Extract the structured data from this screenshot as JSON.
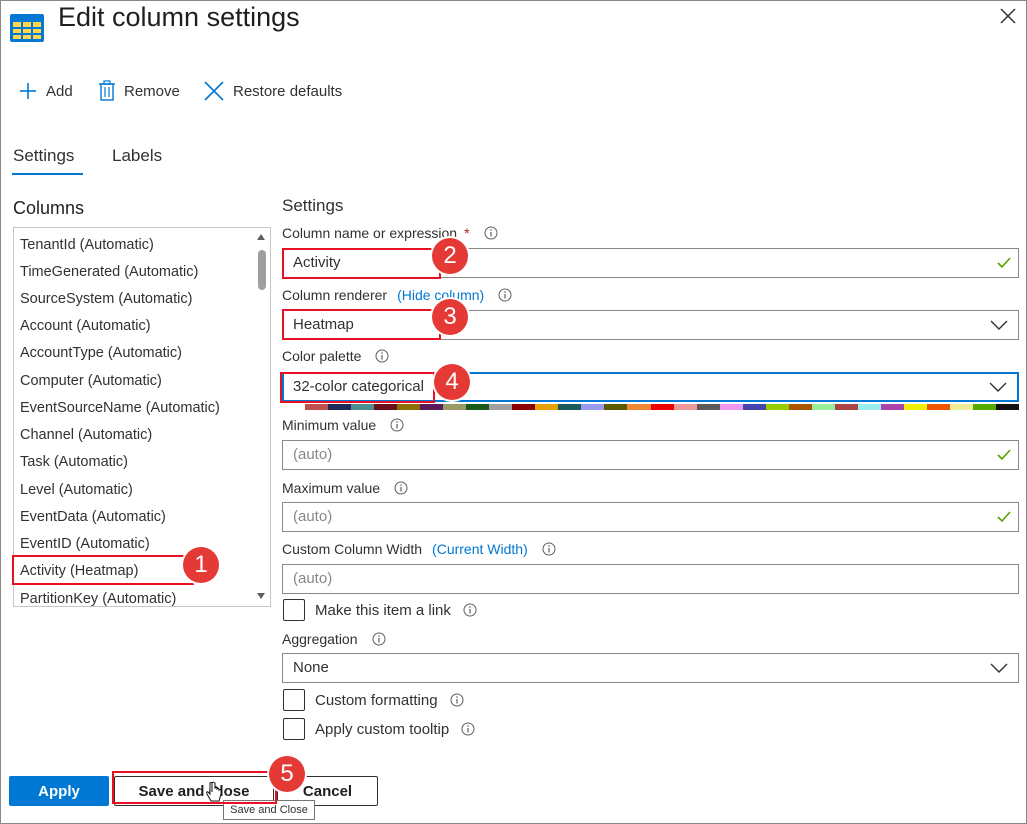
{
  "header": {
    "title": "Edit column settings",
    "close_icon": "close-icon",
    "title_icon": "table-icon"
  },
  "toolbar": {
    "add_label": "Add",
    "remove_label": "Remove",
    "restore_label": "Restore defaults"
  },
  "tabs": [
    {
      "label": "Settings",
      "active": true
    },
    {
      "label": "Labels",
      "active": false
    }
  ],
  "columns": {
    "heading": "Columns",
    "items": [
      "TenantId (Automatic)",
      "TimeGenerated (Automatic)",
      "SourceSystem (Automatic)",
      "Account (Automatic)",
      "AccountType (Automatic)",
      "Computer (Automatic)",
      "EventSourceName (Automatic)",
      "Channel (Automatic)",
      "Task (Automatic)",
      "Level (Automatic)",
      "EventData (Automatic)",
      "EventID (Automatic)",
      "Activity (Heatmap)",
      "PartitionKey (Automatic)"
    ],
    "selected_index": 12
  },
  "settings": {
    "heading": "Settings",
    "column_name": {
      "label": "Column name or expression",
      "required_mark": "*",
      "value": "Activity"
    },
    "renderer": {
      "label": "Column renderer",
      "link": "(Hide column)",
      "value": "Heatmap"
    },
    "palette": {
      "label": "Color palette",
      "value": "32-color categorical",
      "colors": [
        "#ffffff",
        "#c0504d",
        "#1f2a5a",
        "#4d8f8f",
        "#6b0f1a",
        "#8a7000",
        "#5a1a5a",
        "#9a9a66",
        "#1a5a1a",
        "#a0a0a0",
        "#8a0000",
        "#e8a000",
        "#1a5a5a",
        "#9999ee",
        "#5a5a00",
        "#ee8833",
        "#ee0000",
        "#ee9999",
        "#5a5a5a",
        "#ee99ee",
        "#4444aa",
        "#99cc00",
        "#aa5500",
        "#99ee99",
        "#aa4444",
        "#99eeee",
        "#aa44aa",
        "#eeee00",
        "#ee5500",
        "#eeee99",
        "#55aa00",
        "#111111"
      ]
    },
    "min_value": {
      "label": "Minimum value",
      "placeholder": "(auto)"
    },
    "max_value": {
      "label": "Maximum value",
      "placeholder": "(auto)"
    },
    "custom_width": {
      "label": "Custom Column Width",
      "link": "(Current Width)",
      "placeholder": "(auto)"
    },
    "make_link": {
      "label": "Make this item a link",
      "checked": false
    },
    "aggregation": {
      "label": "Aggregation",
      "value": "None"
    },
    "custom_formatting": {
      "label": "Custom formatting",
      "checked": false
    },
    "custom_tooltip": {
      "label": "Apply custom tooltip",
      "checked": false
    }
  },
  "footer": {
    "apply_label": "Apply",
    "save_close_label": "Save and Close",
    "cancel_label": "Cancel",
    "tooltip_text": "Save and Close"
  },
  "annotations": {
    "badge_1": "1",
    "badge_2": "2",
    "badge_3": "3",
    "badge_4": "4",
    "badge_5": "5",
    "highlight_color": "#e81123"
  },
  "colors": {
    "accent": "#0078d4",
    "success_check": "#57a300",
    "badge": "#e53935"
  }
}
